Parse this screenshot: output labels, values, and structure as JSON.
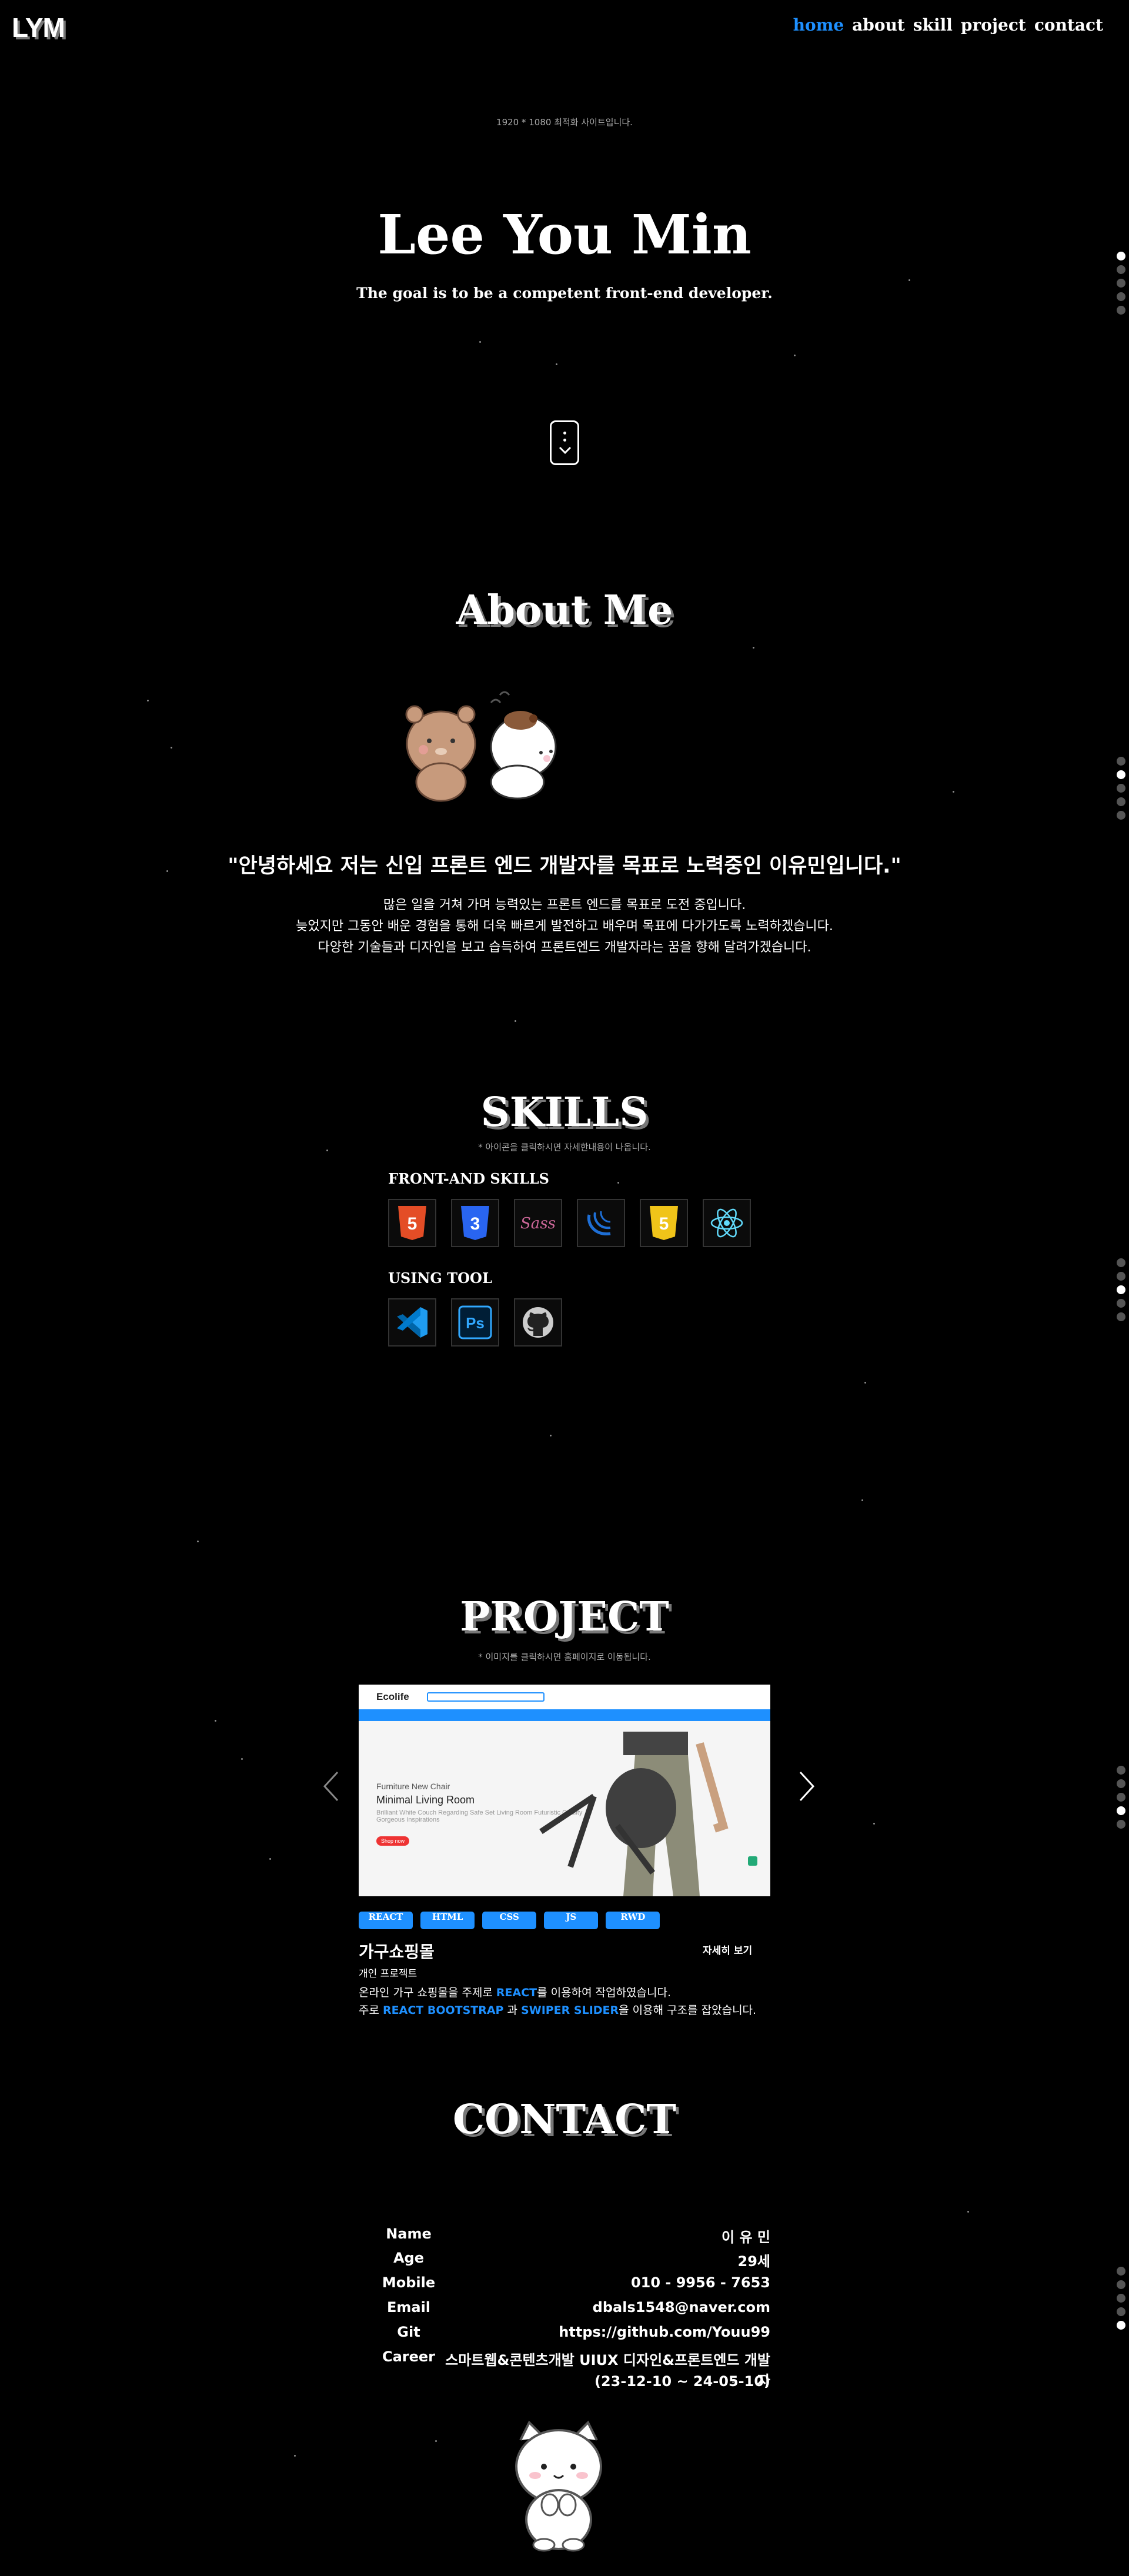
{
  "header": {
    "logo": "LYM",
    "nav": [
      "home",
      "about",
      "skill",
      "project",
      "contact"
    ]
  },
  "hero": {
    "note": "1920 * 1080 최적화 사이트입니다.",
    "title": "Lee You Min",
    "subtitle": "The goal is to be a competent front-end developer."
  },
  "about": {
    "title": "About Me",
    "quote": "\"안녕하세요 저는 신입 프론트 엔드 개발자를 목표로 노력중인 이유민입니다.\"",
    "lines": [
      "많은 일을 거쳐 가며 능력있는 프론트 엔드를 목표로 도전 중입니다.",
      "늦었지만 그동안 배운 경험을 통해 더욱 빠르게 발전하고 배우며 목표에 다가가도록 노력하겠습니다.",
      "다양한 기술들과 디자인을 보고 습득하여 프론트엔드 개발자라는 꿈을 향해 달려가겠습니다."
    ]
  },
  "skills": {
    "title": "SKILLS",
    "note": "* 아이콘을 클릭하시면 자세한내용이 나옵니다.",
    "front_heading": "FRONT-AND SKILLS",
    "tool_heading": "USING TOOL",
    "front_icons": [
      "html5-icon",
      "css3-icon",
      "sass-icon",
      "jquery-icon",
      "javascript-icon",
      "react-icon"
    ],
    "tool_icons": [
      "vscode-icon",
      "photoshop-icon",
      "github-icon"
    ],
    "icon_labels": {
      "html": "5",
      "css": "3",
      "sass": "Sass",
      "js": "5",
      "ps": "Ps"
    }
  },
  "project": {
    "title": "PROJECT",
    "note": "* 이미지를 클릭하시면 홈페이지로 이동됩니다.",
    "slide": {
      "brand": "Ecolife",
      "tag": "Furniture New Chair",
      "headline": "Minimal Living Room",
      "desc": "Brilliant White Couch Regarding Safe Set Living Room Futuristic Quality Gorgeous Inspirations",
      "btn": "Shop now"
    },
    "tags": [
      "REACT",
      "HTML",
      "CSS",
      "JS",
      "RWD"
    ],
    "name": "가구쇼핑몰",
    "kind": "개인 프로젝트",
    "detail_link": "자세히 보기",
    "line1_pre": "온라인 가구 쇼핑몰을 주제로 ",
    "line1_hl": "REACT",
    "line1_post": "를 이용하여 작업하였습니다.",
    "line2_pre": "주로 ",
    "line2_hl1": "REACT BOOTSTRAP",
    "line2_mid": " 과 ",
    "line2_hl2": "SWIPER SLIDER",
    "line2_post": "을 이용해 구조를 잡았습니다."
  },
  "contact": {
    "title": "CONTACT",
    "rows": [
      {
        "k": "Name",
        "v": "이 유 민"
      },
      {
        "k": "Age",
        "v": "29세"
      },
      {
        "k": "Mobile",
        "v": "010 - 9956 - 7653"
      },
      {
        "k": "Email",
        "v": "dbals1548@naver.com"
      },
      {
        "k": "Git",
        "v": "https://github.com/Youu99"
      },
      {
        "k": "Career",
        "v": "스마트웹&콘텐츠개발 UIUX 디자인&프론트엔드 개발자"
      },
      {
        "k": "",
        "v": "(23-12-10 ~ 24-05-10)"
      }
    ]
  },
  "colors": {
    "accent": "#1e90ff",
    "background": "#000000"
  }
}
